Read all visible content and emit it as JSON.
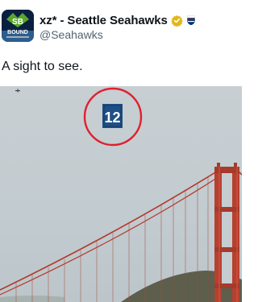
{
  "author": {
    "display_name": "xz* - Seattle Seahawks",
    "handle": "@Seahawks",
    "verified_badge": "gold-verified-icon",
    "affiliate_badge": "nfl-shield-icon",
    "avatar_text_top": "SB",
    "avatar_text_bottom": "BOUND"
  },
  "tweet": {
    "text": "A sight to see."
  },
  "media": {
    "banner_number": "12",
    "highlight_color": "#e0202f",
    "bridge_color": "#c0392b"
  }
}
